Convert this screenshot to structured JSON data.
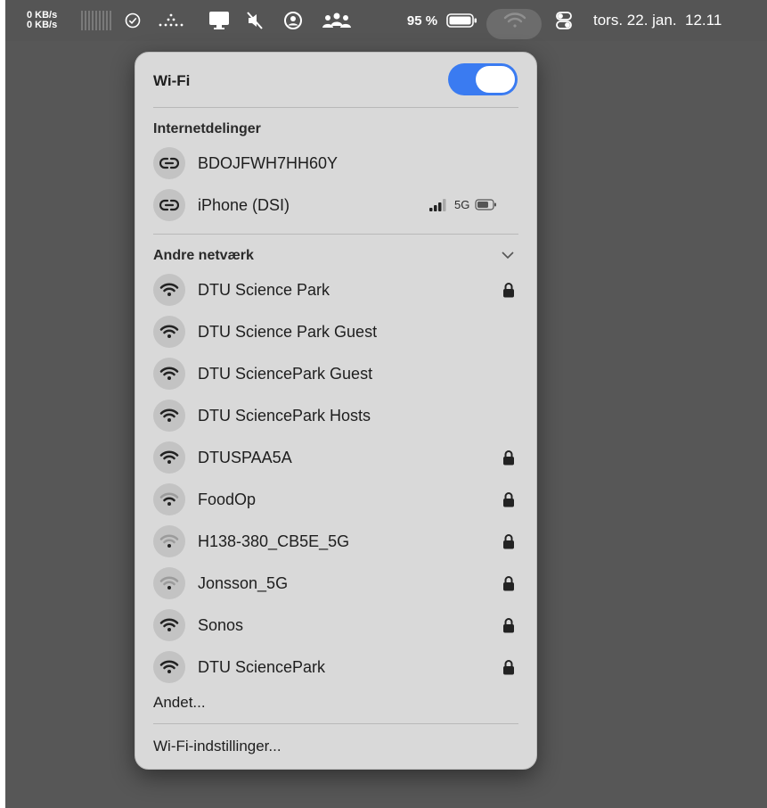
{
  "menubar": {
    "net_up": "0 KB/s",
    "net_down": "0 KB/s",
    "battery_percent": "95 %",
    "clock": "tors. 22. jan.  12.11",
    "icons": [
      "network-activity-bars-icon",
      "check-circle-icon",
      "dots-icon",
      "display-icon",
      "muted-speaker-icon",
      "user-circle-icon",
      "people-icon",
      "battery-icon",
      "wifi-icon",
      "control-center-icon"
    ]
  },
  "wifi_panel": {
    "title": "Wi-Fi",
    "toggle_on": true,
    "accent_color": "#3a7bf1",
    "hotspots_label": "Internetdelinger",
    "hotspots": [
      {
        "name": "BDOJFWH7HH60Y"
      },
      {
        "name": "iPhone (DSI)",
        "signal": "5G"
      }
    ],
    "other_label": "Andre netværk",
    "other_networks": [
      {
        "name": "DTU Science Park",
        "locked": true,
        "strength": 3
      },
      {
        "name": "DTU Science Park Guest",
        "locked": false,
        "strength": 3
      },
      {
        "name": "DTU SciencePark Guest",
        "locked": false,
        "strength": 3
      },
      {
        "name": "DTU SciencePark Hosts",
        "locked": false,
        "strength": 3
      },
      {
        "name": "DTUSPAA5A",
        "locked": true,
        "strength": 3
      },
      {
        "name": "FoodOp",
        "locked": true,
        "strength": 2
      },
      {
        "name": "H138-380_CB5E_5G",
        "locked": true,
        "strength": 1
      },
      {
        "name": "Jonsson_5G",
        "locked": true,
        "strength": 1
      },
      {
        "name": "Sonos",
        "locked": true,
        "strength": 3
      },
      {
        "name": "DTU SciencePark",
        "locked": true,
        "strength": 3
      }
    ],
    "other_item": "Andet...",
    "settings_item": "Wi-Fi-indstillinger..."
  }
}
